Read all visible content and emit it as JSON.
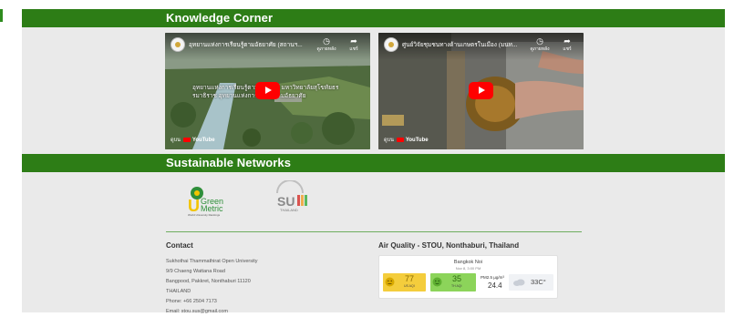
{
  "sections": {
    "knowledge_title": "Knowledge Corner",
    "sustainable_title": "Sustainable Networks"
  },
  "videos": [
    {
      "title": "อุทยานแห่งการเรียนรู้ตามอัธยาศัย (สถานฯ...",
      "overlay_text": "อุทยานแห่งการเรียนรู้ตามอัธยาศัย มหาวิทยาลัยสุโขทัยธรรมาธิราช อุทยานแห่งการเรียนรู้ตามอัธยาศัย",
      "watch_later": "ดูภายหลัง",
      "share": "แชร์",
      "watch_on": "ดูบน",
      "platform": "YouTube"
    },
    {
      "title": "ศูนย์วิจัยชุมชนทางด้านเกษตรในเมือง (มนท...",
      "overlay_text": "",
      "watch_later": "ดูภายหลัง",
      "share": "แชร์",
      "watch_on": "ดูบน",
      "platform": "YouTube"
    }
  ],
  "logos": {
    "greenmetric_line1": "Green",
    "greenmetric_line2": "Metric",
    "greenmetric_sub": "World University Rankings",
    "sdsn_label": "THAILAND"
  },
  "contact": {
    "heading": "Contact",
    "lines": [
      "Sukhothai Thammathirat Open University",
      "9/9 Chaeng Wattana Road",
      "Bangpood, Pakkret, Nonthaburi 11120",
      "THAILAND",
      "Phone: +66 2504 7173",
      "Email: stou.sus@gmail.com"
    ]
  },
  "air_quality": {
    "heading": "Air Quality - STOU, Nonthaburi, Thailand",
    "city": "Bangkok Noi",
    "time": "Nov 8, 3:00 PM",
    "aqi_us": "77",
    "aqi_us_unit": "US AQI",
    "aqi_th": "35",
    "aqi_th_unit": "TH AQI",
    "pm_label": "PM2.5 µg/m³",
    "pm_value": "24.4",
    "temperature": "33C°",
    "colors": {
      "us": "#f4cd3c",
      "th": "#8cd45a"
    }
  }
}
